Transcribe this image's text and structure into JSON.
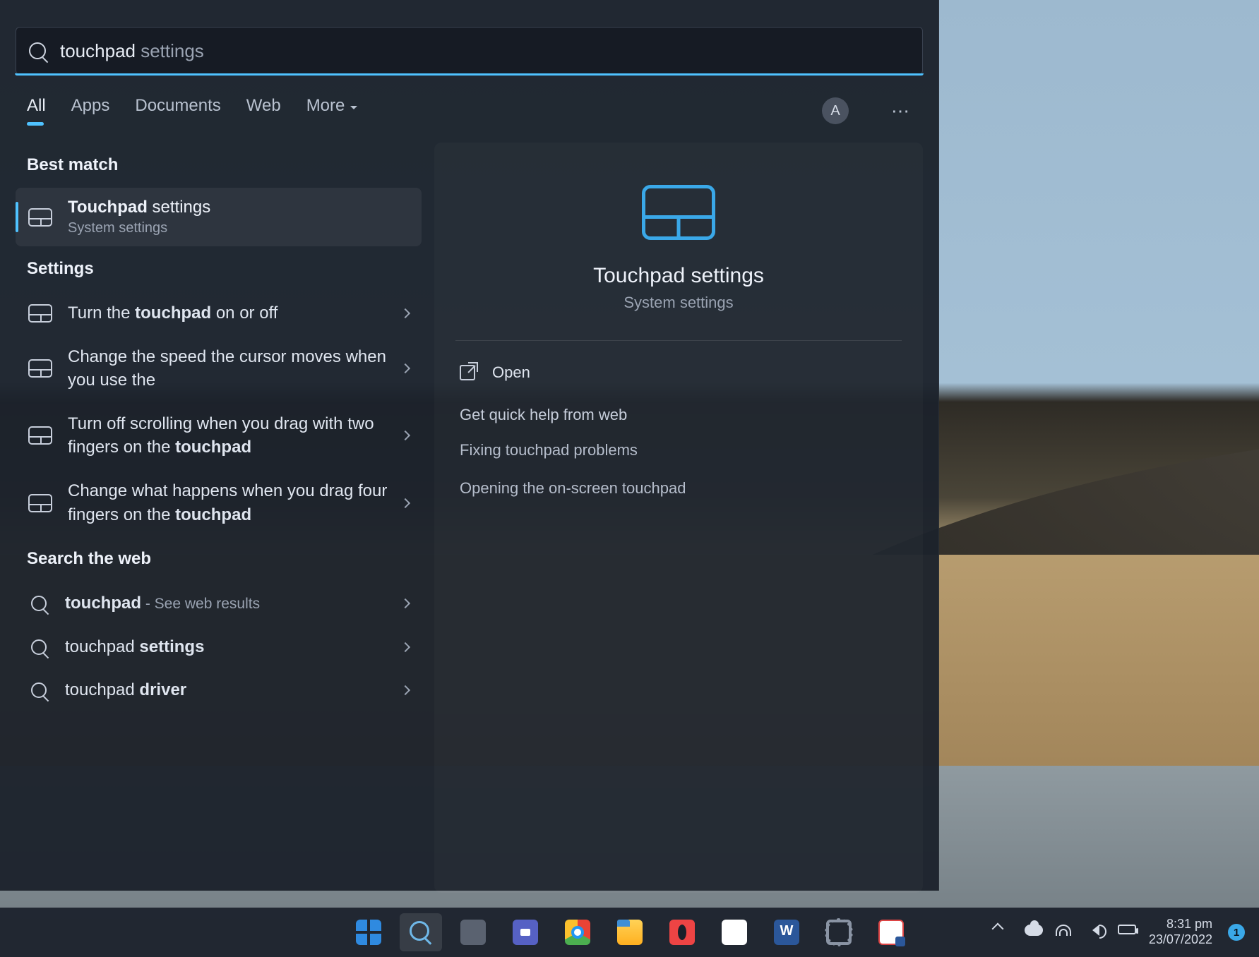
{
  "search": {
    "query_bold": "touchpad",
    "query_rest": " settings"
  },
  "tabs": [
    "All",
    "Apps",
    "Documents",
    "Web",
    "More"
  ],
  "avatar_letter": "A",
  "sections": {
    "best_match": "Best match",
    "settings": "Settings",
    "web": "Search the web"
  },
  "best": {
    "title_bold": "Touchpad",
    "title_rest": " settings",
    "subtitle": "System settings"
  },
  "settings_items": [
    {
      "pre": "Turn the ",
      "hl": "touchpad",
      "post": " on or off"
    },
    {
      "pre": "Change the speed the cursor moves when you use the",
      "hl": "",
      "post": ""
    },
    {
      "pre": "Turn off scrolling when you drag with two fingers on the ",
      "hl": "touchpad",
      "post": ""
    },
    {
      "pre": "Change what happens when you drag four fingers on the ",
      "hl": "touchpad",
      "post": ""
    }
  ],
  "web_items": [
    {
      "bold": "touchpad",
      "rest": "",
      "suffix": " - See web results"
    },
    {
      "bold": "",
      "rest": "touchpad ",
      "suffix": "",
      "bold2": "settings"
    },
    {
      "bold": "",
      "rest": "touchpad ",
      "suffix": "",
      "bold2": "driver"
    }
  ],
  "right": {
    "title": "Touchpad settings",
    "subtitle": "System settings",
    "open": "Open",
    "help_title": "Get quick help from web",
    "links": [
      "Fixing touchpad problems",
      "Opening the on-screen touchpad"
    ]
  },
  "taskbar": {
    "time": "8:31 pm",
    "date": "23/07/2022",
    "notif_count": "1"
  }
}
